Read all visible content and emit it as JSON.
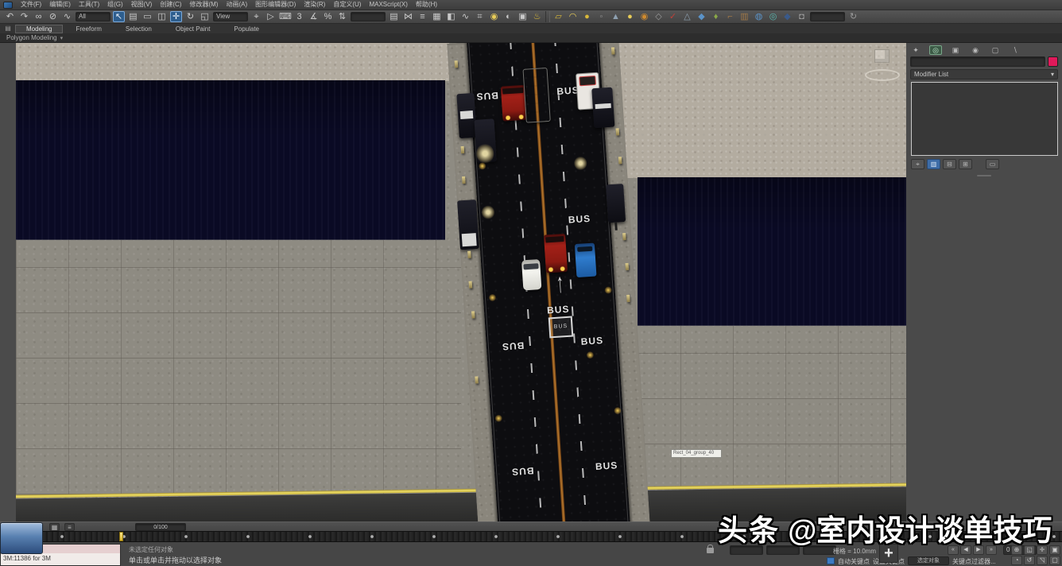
{
  "menu": {
    "items": [
      "文件(F)",
      "编辑(E)",
      "工具(T)",
      "组(G)",
      "视图(V)",
      "创建(C)",
      "修改器(M)",
      "动画(A)",
      "图形编辑器(D)",
      "渲染(R)",
      "自定义(U)",
      "MAXScript(X)",
      "帮助(H)"
    ]
  },
  "toolbar": {
    "filter_label": "All",
    "coord_label": "View",
    "named_sets_value": "",
    "icons": [
      "↶",
      "↷",
      "∞",
      "⊘",
      "∿",
      "↖",
      "▤",
      "▭",
      "◫",
      "✛",
      "↻",
      "◱",
      "⌖",
      "▷",
      "⌨",
      "3",
      "∡",
      "%",
      "⇅",
      "▤",
      "⋈",
      "≡",
      "▦",
      "◧",
      "∿",
      "⌗",
      "◉",
      "◐",
      "▣",
      "♨",
      "▱",
      "◠",
      "●",
      "◦",
      "▲",
      "●",
      "◉",
      "◇",
      "✓",
      "△",
      "◆",
      "♦",
      "⌐",
      "▥",
      "◍",
      "◎",
      "◆",
      "◘",
      "↻"
    ]
  },
  "ribbon": {
    "tabs": [
      "Modeling",
      "Freeform",
      "Selection",
      "Object Paint",
      "Populate"
    ],
    "panel_label": "Polygon Modeling",
    "caret": "▾"
  },
  "viewport": {
    "bus_label": "BUS",
    "arrow_glyph": "↑",
    "tooltip_text": "Rect_04_group_40"
  },
  "command_panel": {
    "tab_icons": [
      "✦",
      "◎",
      "▣",
      "◉",
      "▢",
      "∖"
    ],
    "object_name": "",
    "modifier_list_label": "Modifier List",
    "drop_caret": "▾",
    "stack_buttons": [
      "⌖",
      "▥",
      "⊟",
      "⊞",
      "▭"
    ],
    "swatch_color": "#e0195a"
  },
  "timeline": {
    "readout": "0/100",
    "track_icon_a": "▦",
    "track_icon_b": "≡"
  },
  "status": {
    "listener_text": "3M:11386 for 3M",
    "line1": "未选定任何对象",
    "line2": "单击或单击并拖动以选择对象",
    "x_value": "",
    "y_value": "",
    "z_value": "",
    "grid_label": "栅格 = 10.0mm",
    "auto_key": "自动关键点",
    "set_key": "设置关键点",
    "selected_label": "选定对象",
    "key_filters": "关键点过滤器...",
    "time_value": "0",
    "plus_glyph": "+",
    "playback": [
      "«",
      "◀",
      "▶",
      "»"
    ],
    "nav_icons_row1": [
      "⊕",
      "◱",
      "✛",
      "▣"
    ],
    "nav_icons_row2": [
      "◔",
      "↺",
      "◹",
      "▢"
    ]
  },
  "watermark": {
    "bold": "头条",
    "rest": " @室内设计谈单技巧"
  },
  "colors": {
    "accent_blue": "#3d6fa8",
    "object_swatch": "#e0195a",
    "yellow_curb": "#e6d24b",
    "navy_block": "#0a0a24",
    "asphalt": "#0d0d10",
    "pavement": "#8e8b82",
    "median_orange": "#b97a2e"
  }
}
